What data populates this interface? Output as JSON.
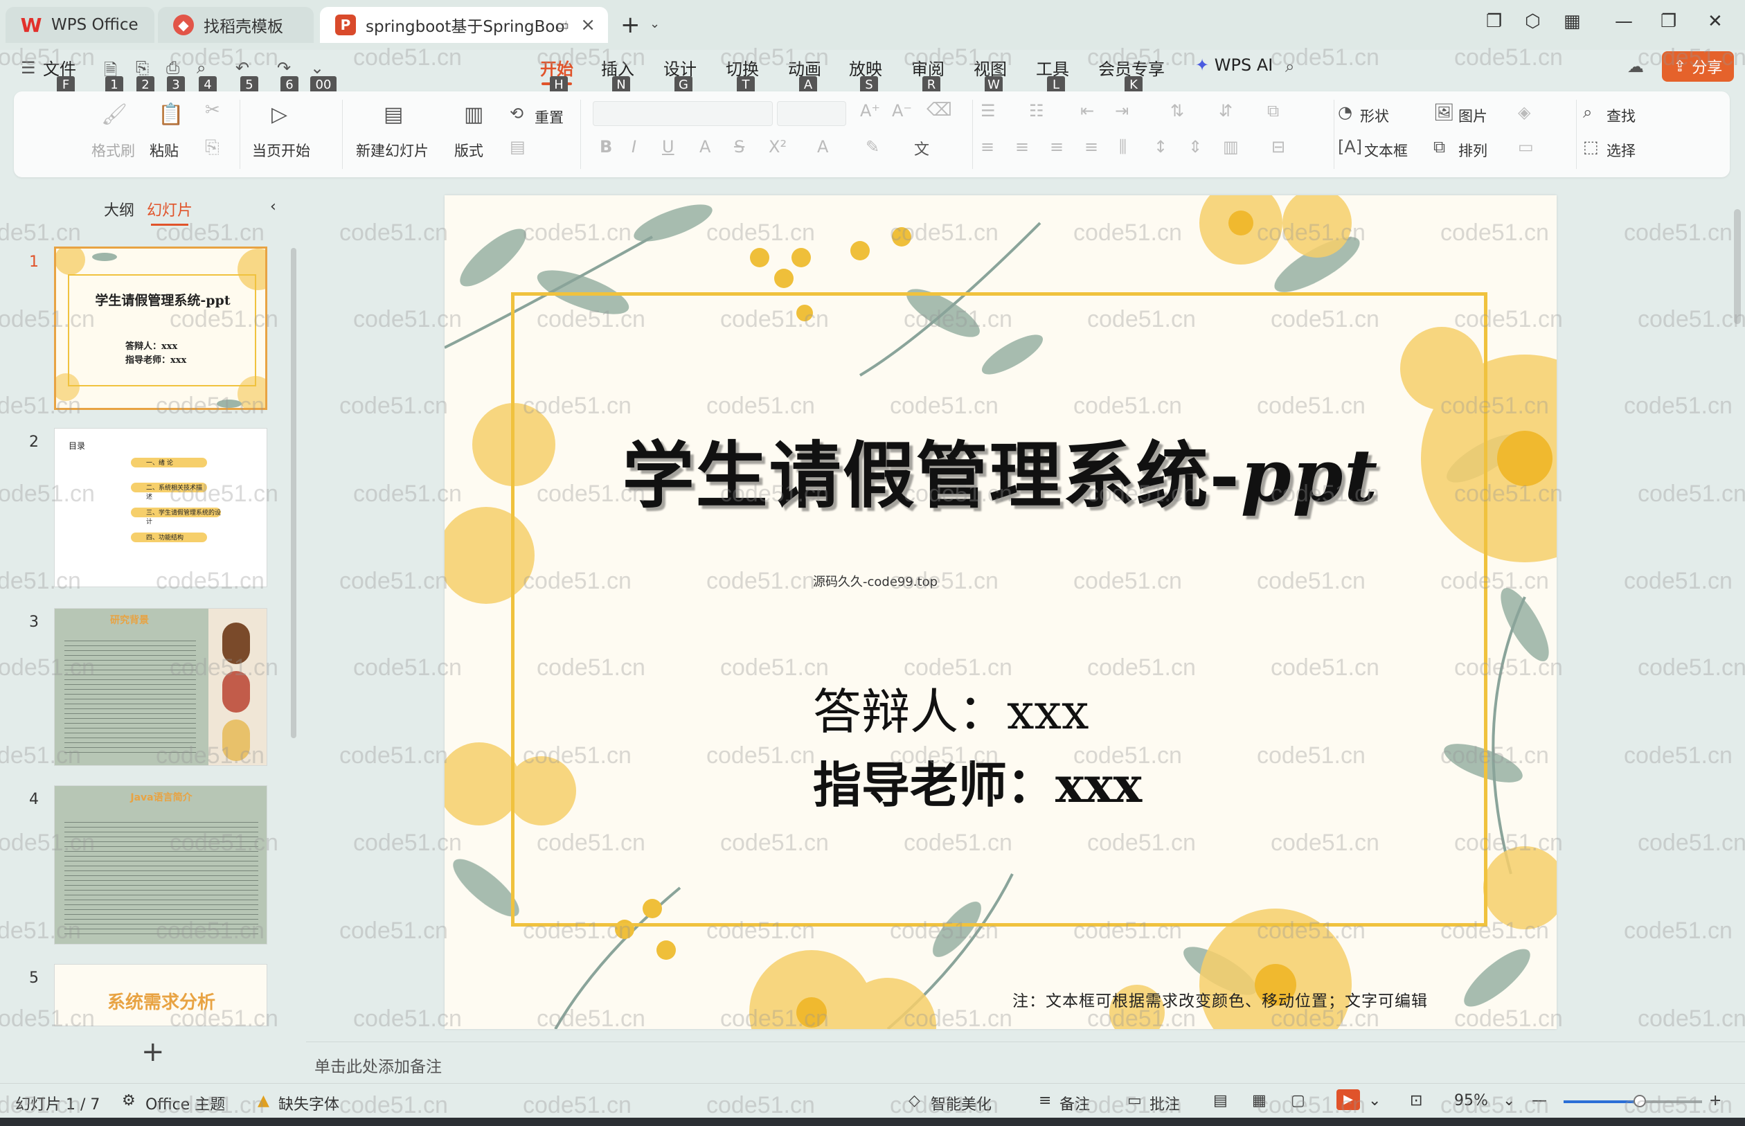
{
  "tabs": [
    {
      "label": "WPS Office",
      "icon": "wps-logo-icon"
    },
    {
      "label": "找稻壳模板",
      "icon": "docer-icon"
    },
    {
      "label": "springboot基于SpringBoot的",
      "icon": "ppt-file-icon"
    }
  ],
  "menu": {
    "file": "文件",
    "items": [
      "开始",
      "插入",
      "设计",
      "切换",
      "动画",
      "放映",
      "审阅",
      "视图",
      "工具",
      "会员专享"
    ],
    "keytips": [
      "F",
      "1",
      "2",
      "3",
      "4",
      "5",
      "6",
      "00",
      "H",
      "N",
      "G",
      "T",
      "A",
      "S",
      "R",
      "W",
      "L",
      "K"
    ],
    "wps_ai": "WPS AI",
    "share": "分享"
  },
  "ribbon": {
    "format_painter": "格式刷",
    "paste": "粘贴",
    "play_from_current": "当页开始",
    "new_slide": "新建幻灯片",
    "layout": "版式",
    "reset": "重置",
    "shape": "形状",
    "image": "图片",
    "textbox": "文本框",
    "arrange": "排列",
    "find": "查找",
    "select": "选择"
  },
  "left_panel": {
    "tab_outline": "大纲",
    "tab_slides": "幻灯片",
    "slide_numbers": [
      "1",
      "2",
      "3",
      "4",
      "5"
    ],
    "thumb1_title": "学生请假管理系统-ppt",
    "thumb1_lines": [
      "答辩人：xxx",
      "指导老师：xxx"
    ],
    "thumb2_title": "目录",
    "thumb2_items": [
      "一、绪 论",
      "二、系统相关技术描述",
      "三、学生请假管理系统的设计",
      "四、功能结构"
    ],
    "thumb3_title": "研究背景",
    "thumb4_title": "Java语言简介",
    "thumb5_title": "系统需求分析"
  },
  "slide": {
    "title_main": "学生请假管理系统-",
    "title_italic": "ppt",
    "subtitle": "源码久久-code99.top",
    "line1": "答辩人：xxx",
    "line2": "指导老师：xxx",
    "note": "注：文本框可根据需求改变颜色、移动位置；文字可编辑"
  },
  "notes_placeholder": "单击此处添加备注",
  "status": {
    "slide_count": "幻灯片 1 / 7",
    "theme": "Office 主题",
    "missing_font": "缺失字体",
    "beautify": "智能美化",
    "notes": "备注",
    "comments": "批注",
    "zoom": "95%",
    "zoom_level": 0.55
  },
  "watermark": "code51.cn",
  "colors": {
    "accent": "#e0532a",
    "frame": "#f0c23e",
    "flower": "#f6cf6b",
    "leaf": "#9db5a8"
  }
}
